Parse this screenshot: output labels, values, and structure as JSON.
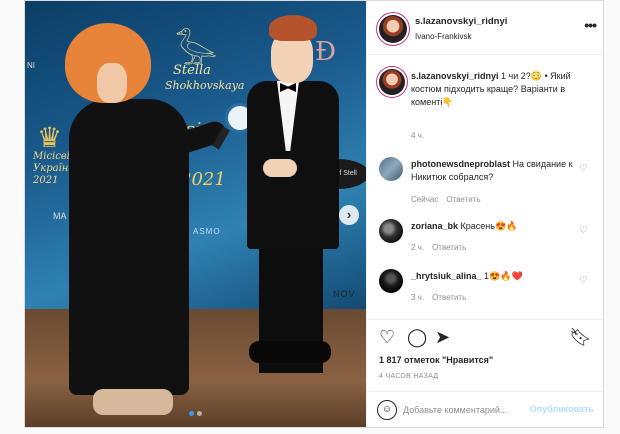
{
  "post": {
    "author": "s.lazanovskyi_ridnyi",
    "location": "Ivano-Frankivsk",
    "more_icon": "more-horizontal-icon",
    "photo": {
      "banner": {
        "stella": "Stella",
        "stella2": "Shokhovskaya",
        "miss": "Місісвіт",
        "year": "2021",
        "left_logo": "Місісвіт вс\nУкраїна\n2021",
        "bubble": "Miss of Stell",
        "nov": "NOV",
        "asmo": "ASMO",
        "ma": "MA",
        "ni": "NI"
      },
      "carousel_total": 2,
      "carousel_active": 0
    },
    "caption": {
      "username": "s.lazanovskyi_ridnyi",
      "text": " 1 чи 2?😳 • Який костюм підходить краще? Варіанти в коменті👇",
      "time": "4 ч."
    },
    "comments": [
      {
        "username": "photonewsdneproblast",
        "text": " На свидание к Никитюк собрался?",
        "time": "Сейчас",
        "reply": "Ответить"
      },
      {
        "username": "zoriana_bk",
        "text": " Красень😍🔥",
        "time": "2 ч.",
        "reply": "Ответить"
      },
      {
        "username": "_hrytsiuk_alina_",
        "text": " 1😍🔥❤️",
        "time": "3 ч.",
        "reply": "Ответить"
      }
    ],
    "likes": "1 817 отметок \"Нравится\"",
    "time_ago": "4 ЧАСОВ НАЗАД",
    "add_comment": {
      "placeholder": "Добавьте комментарий...",
      "publish": "Опубликовать"
    }
  }
}
